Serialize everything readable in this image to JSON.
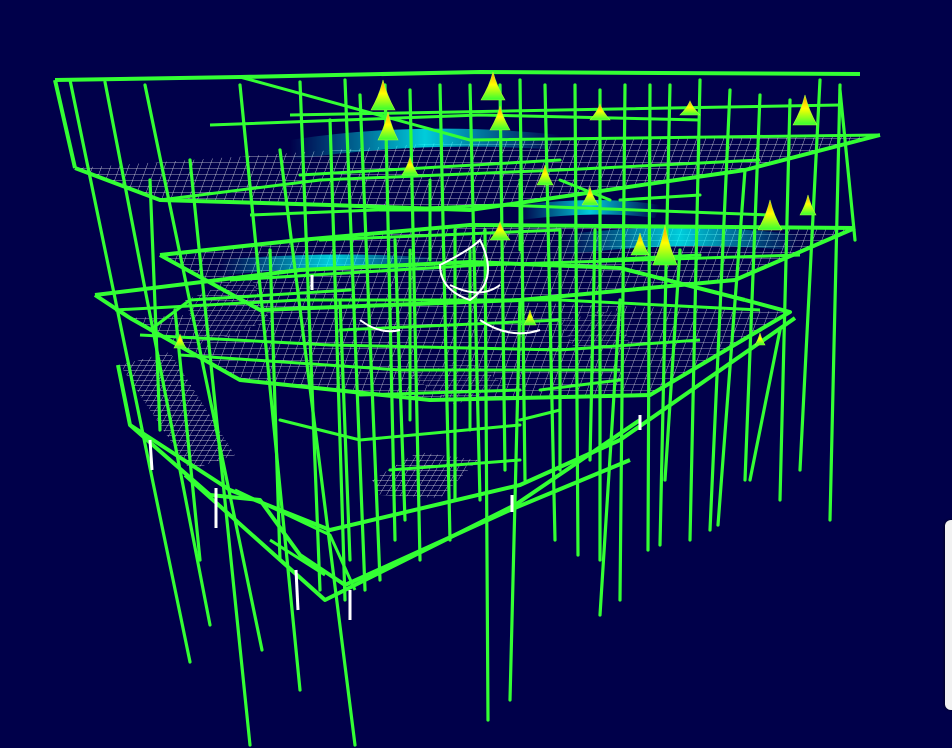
{
  "viewport": {
    "model": "3d-structural-frame",
    "view": "isometric",
    "display": "deformed-shape-with-stress-contours",
    "background_color": "#00004a",
    "frame_color": "#33ff33",
    "mesh_color": "#ffffff",
    "contour_colors": [
      "#00ffff",
      "#33ff33",
      "#ffff00",
      "#ff9900"
    ]
  },
  "side_panel": {
    "state": "collapsed",
    "color": "#f2f2f2"
  }
}
